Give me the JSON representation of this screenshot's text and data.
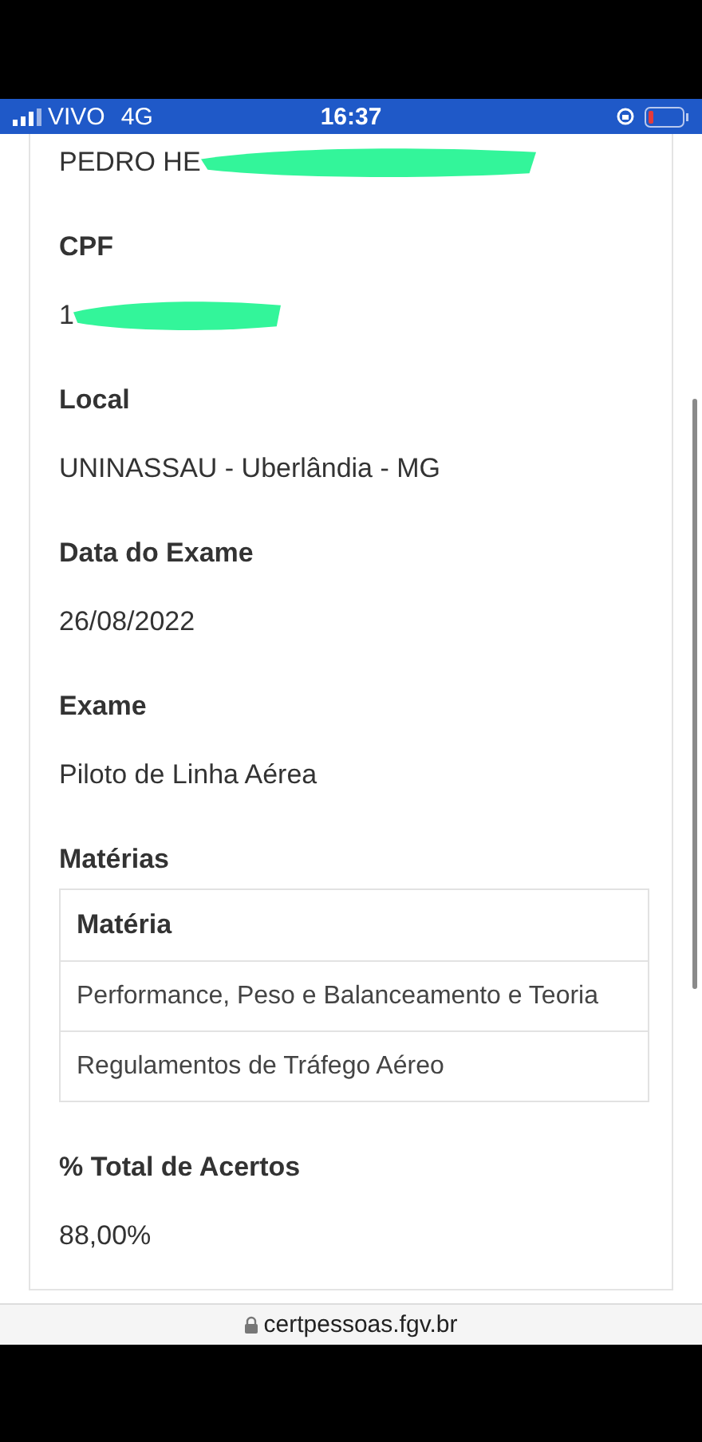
{
  "status_bar": {
    "carrier": "VIVO",
    "network": "4G",
    "time": "16:37"
  },
  "sections": [
    {
      "kind": "field",
      "value": "PEDRO HE",
      "redacted": true
    },
    {
      "kind": "field",
      "label": "CPF",
      "value": "1",
      "redacted": true
    },
    {
      "kind": "field",
      "label": "Local",
      "value": "UNINASSAU - Uberlândia - MG"
    },
    {
      "kind": "field",
      "label": "Data do Exame",
      "value": "26/08/2022"
    },
    {
      "kind": "field",
      "label": "Exame",
      "value": "Piloto de Linha Aérea"
    },
    {
      "kind": "table",
      "label": "Matérias",
      "columns": [
        "Matéria"
      ],
      "rows": [
        "Performance, Peso e Balanceamento e Teoria",
        "Regulamentos de Tráfego Aéreo"
      ]
    },
    {
      "kind": "field",
      "label": "% Total de Acertos",
      "value": "88,00%"
    }
  ],
  "address_bar": {
    "url": "certpessoas.fgv.br"
  }
}
